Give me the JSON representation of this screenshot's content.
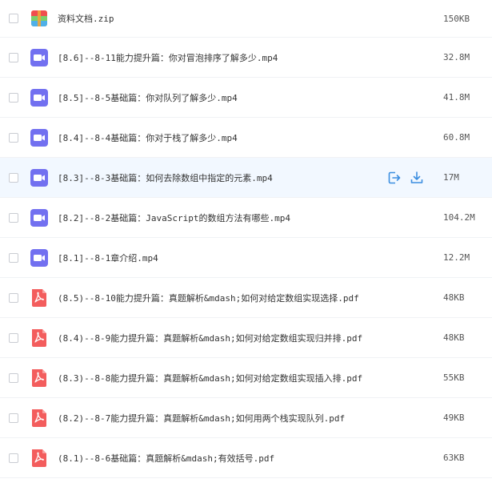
{
  "files": [
    {
      "name": "资料文档.zip",
      "size": "150KB",
      "type": "zip",
      "icon": "zip-archive-icon"
    },
    {
      "name": "[8.6]--8-11能力提升篇：你对冒泡排序了解多少.mp4",
      "size": "32.8M",
      "type": "video",
      "icon": "video-file-icon"
    },
    {
      "name": "[8.5]--8-5基础篇：你对队列了解多少.mp4",
      "size": "41.8M",
      "type": "video",
      "icon": "video-file-icon"
    },
    {
      "name": "[8.4]--8-4基础篇：你对于栈了解多少.mp4",
      "size": "60.8M",
      "type": "video",
      "icon": "video-file-icon"
    },
    {
      "name": "[8.3]--8-3基础篇：如何去除数组中指定的元素.mp4",
      "size": "17M",
      "type": "video",
      "icon": "video-file-icon",
      "hovered": true
    },
    {
      "name": "[8.2]--8-2基础篇：JavaScript的数组方法有哪些.mp4",
      "size": "104.2M",
      "type": "video",
      "icon": "video-file-icon"
    },
    {
      "name": "[8.1]--8-1章介绍.mp4",
      "size": "12.2M",
      "type": "video",
      "icon": "video-file-icon"
    },
    {
      "name": "(8.5)--8-10能力提升篇：真题解析&mdash;如何对给定数组实现选择.pdf",
      "size": "48KB",
      "type": "pdf",
      "icon": "pdf-file-icon"
    },
    {
      "name": "(8.4)--8-9能力提升篇：真题解析&mdash;如何对给定数组实现归并排.pdf",
      "size": "48KB",
      "type": "pdf",
      "icon": "pdf-file-icon"
    },
    {
      "name": "(8.3)--8-8能力提升篇：真题解析&mdash;如何对给定数组实现插入排.pdf",
      "size": "55KB",
      "type": "pdf",
      "icon": "pdf-file-icon"
    },
    {
      "name": "(8.2)--8-7能力提升篇：真题解析&mdash;如何用两个栈实现队列.pdf",
      "size": "49KB",
      "type": "pdf",
      "icon": "pdf-file-icon"
    },
    {
      "name": "(8.1)--8-6基础篇：真题解析&mdash;有效括号.pdf",
      "size": "63KB",
      "type": "pdf",
      "icon": "pdf-file-icon"
    }
  ],
  "row_actions": {
    "share_icon": "share-icon",
    "download_icon": "download-icon"
  },
  "colors": {
    "video_icon": "#6f6ff0",
    "pdf_icon": "#f25b5b",
    "action_icon": "#3b8ee0",
    "hover_bg": "#f2f8ff"
  }
}
